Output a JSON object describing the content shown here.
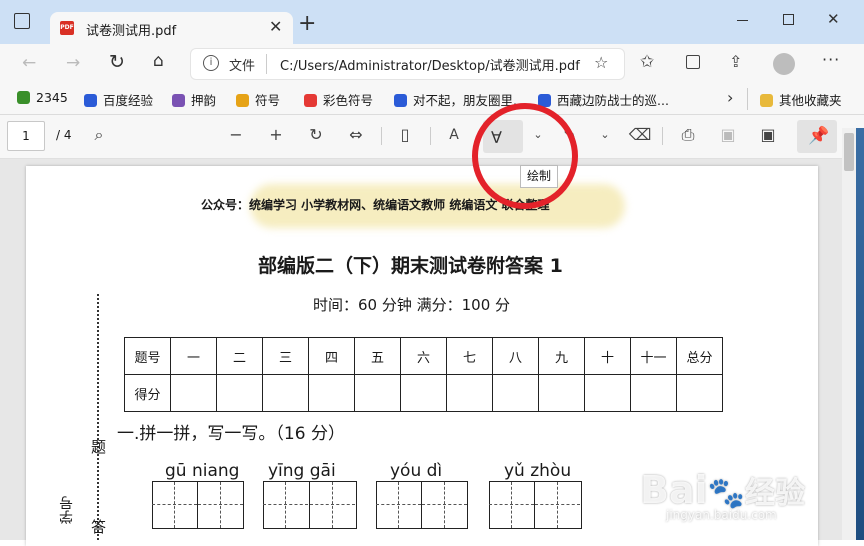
{
  "browser": {
    "tab_title": "试卷测试用.pdf",
    "address_label": "文件",
    "url": "C:/Users/Administrator/Desktop/试卷测试用.pdf"
  },
  "bookmarks": [
    {
      "label": "2345",
      "color": "#3a8f2a"
    },
    {
      "label": "百度经验",
      "color": "#2b5bd7"
    },
    {
      "label": "押韵",
      "color": "#7a52b3"
    },
    {
      "label": "符号",
      "color": "#e6a317"
    },
    {
      "label": "彩色符号",
      "color": "#e53935"
    },
    {
      "label": "对不起，朋友圈里...",
      "color": "#2b5bd7"
    },
    {
      "label": "西藏边防战士的巡...",
      "color": "#2b5bd7"
    }
  ],
  "other_bookmarks": "其他收藏夹",
  "pdf_toolbar": {
    "page": "1",
    "total": "/ 4",
    "tooltip": "绘制"
  },
  "document": {
    "header_line": "公众号：统编学习   小学教材网、统编语文教师   统编语文  联合整理",
    "title": "部编版二（下）期末测试卷附答案 1",
    "subtitle": "时间：60 分钟   满分：100 分",
    "score_headers": [
      "题号",
      "一",
      "二",
      "三",
      "四",
      "五",
      "六",
      "七",
      "八",
      "九",
      "十",
      "十一",
      "总分"
    ],
    "score_row_label": "得分",
    "section1": "一.拼一拼，写一写。（16 分）",
    "pinyin": [
      "gū  niang",
      "yīng gāi",
      "yóu   dì",
      "yǔ zhòu"
    ],
    "side_labels": {
      "ti": "题",
      "da": "答",
      "xuehao": "学号"
    }
  },
  "watermark": {
    "brand": "Bai",
    "brand2": "经验",
    "site": "jingyan.baidu.com"
  },
  "colors": {
    "titlebar": "#cde0f5",
    "annotation_circle": "#e3222a",
    "pdf_icon": "#d93025"
  }
}
